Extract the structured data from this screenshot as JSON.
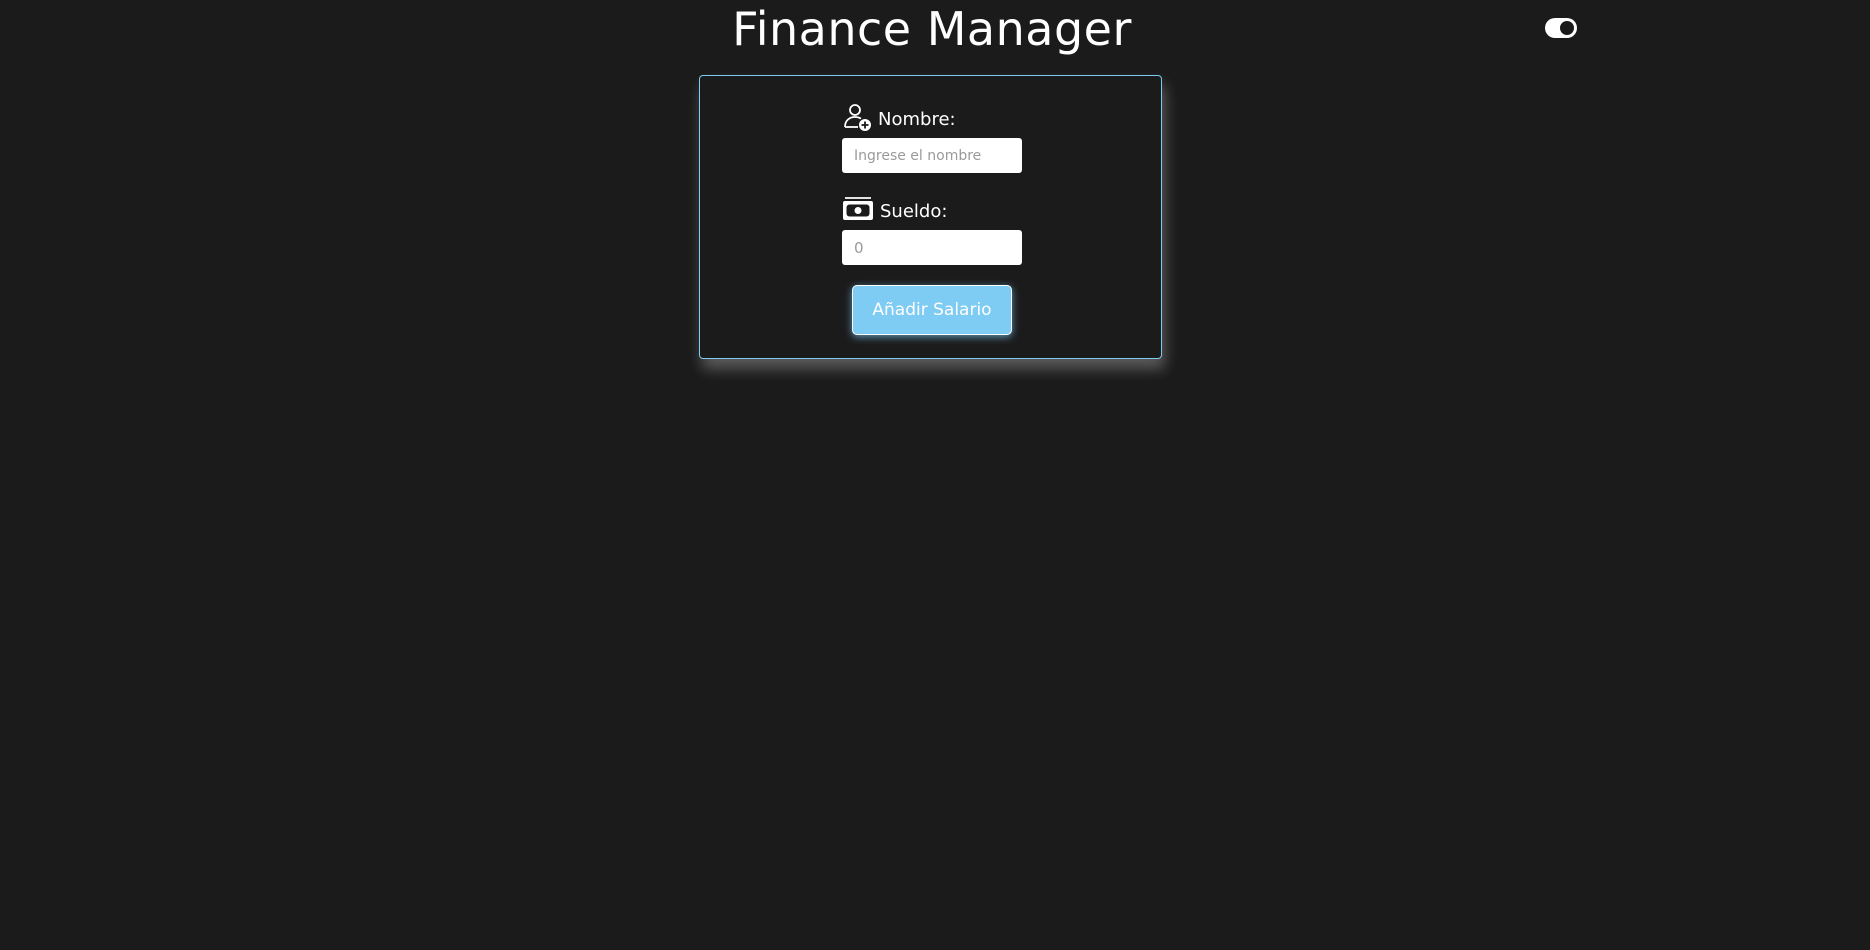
{
  "header": {
    "title": "Finance Manager"
  },
  "theme_toggle": {
    "state": "on"
  },
  "form": {
    "nombre": {
      "label": "Nombre:",
      "icon": "user-plus-icon",
      "placeholder": "Ingrese el nombre",
      "value": ""
    },
    "sueldo": {
      "label": "Sueldo:",
      "icon": "cash-icon",
      "placeholder": "0",
      "value": ""
    },
    "submit_label": "Añadir Salario"
  },
  "colors": {
    "background": "#1b1b1c",
    "accent": "#7ecbf3",
    "text": "#ffffff"
  }
}
